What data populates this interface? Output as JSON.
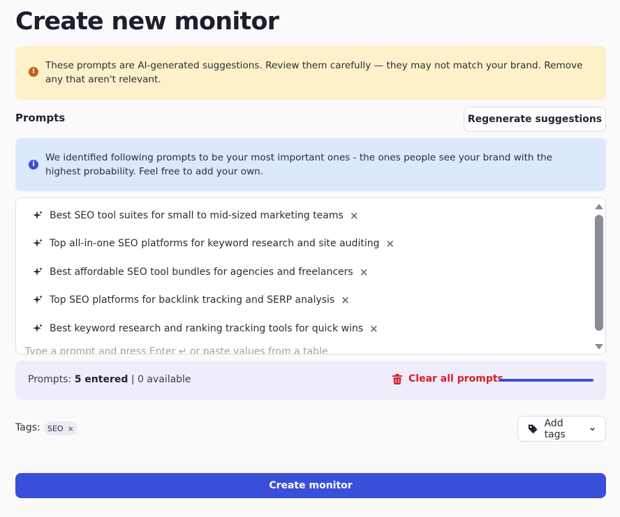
{
  "page": {
    "title": "Create new monitor"
  },
  "warning": {
    "icon": "exclamation-circle-icon",
    "text": "These prompts are AI-generated suggestions. Review them carefully — they may not match your brand. Remove any that aren't relevant."
  },
  "prompts_section": {
    "label": "Prompts",
    "regenerate_label": "Regenerate suggestions",
    "info_icon": "info-circle-icon",
    "info_text": "We identified following prompts to be your most important ones - the ones people see your brand with the highest probability. Feel free to add your own.",
    "items": [
      {
        "label": "Best SEO tool suites for small to mid-sized marketing teams"
      },
      {
        "label": "Top all-in-one SEO platforms for keyword research and site auditing"
      },
      {
        "label": "Best affordable SEO tool bundles for agencies and freelancers"
      },
      {
        "label": "Top SEO platforms for backlink tracking and SERP analysis"
      },
      {
        "label": "Best keyword research and ranking tracking tools for quick wins"
      }
    ],
    "input_placeholder": "Type a prompt and press Enter ↵ or paste values from a table"
  },
  "stats": {
    "prefix": "Prompts:",
    "entered": "5 entered",
    "separator": "|",
    "available": "0 available",
    "clear_label": "Clear all prompts",
    "progress_fraction": 1.0,
    "colors": {
      "accent": "#3a4fd9",
      "danger": "#d4202c"
    }
  },
  "tags": {
    "label": "Tags:",
    "items": [
      {
        "label": "SEO"
      }
    ],
    "add_label": "Add tags"
  },
  "submit": {
    "label": "Create monitor"
  }
}
